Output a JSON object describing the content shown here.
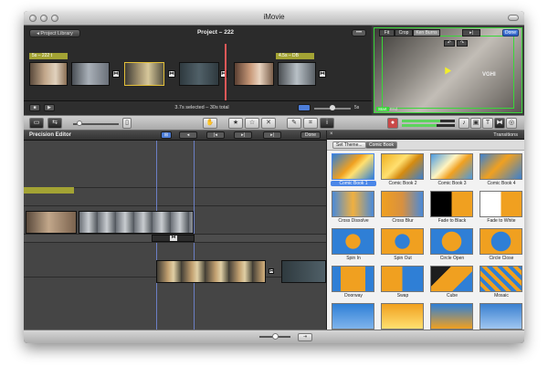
{
  "app": {
    "title": "iMovie"
  },
  "project": {
    "library_button": "◂ Project Library",
    "title": "Project – 222",
    "title_tags": [
      "5s – 222 t",
      "4.5s – DB"
    ],
    "status": "3.7s selected – 30s total",
    "zoom_label": "5s"
  },
  "viewer": {
    "buttons": [
      "Fit",
      "Crop",
      "Ken Burns"
    ],
    "active_button": "Ken Burns",
    "done": "Done",
    "start_label": "Start",
    "end_label": "End",
    "watermark": "VGHI"
  },
  "editor": {
    "title": "Precision Editor",
    "done": "Done"
  },
  "transitions": {
    "panel_title": "Transitions",
    "tabs": [
      "Set Theme...",
      "Comic Book"
    ],
    "active_tab": "Comic Book",
    "items": [
      {
        "label": "Comic Book 1",
        "selected": true
      },
      {
        "label": "Comic Book 2",
        "selected": false
      },
      {
        "label": "Comic Book 3",
        "selected": false
      },
      {
        "label": "Comic Book 4",
        "selected": false
      },
      {
        "label": "Cross Dissolve",
        "selected": false
      },
      {
        "label": "Cross Blur",
        "selected": false
      },
      {
        "label": "Fade to Black",
        "selected": false
      },
      {
        "label": "Fade to White",
        "selected": false
      },
      {
        "label": "Spin In",
        "selected": false
      },
      {
        "label": "Spin Out",
        "selected": false
      },
      {
        "label": "Circle Open",
        "selected": false
      },
      {
        "label": "Circle Close",
        "selected": false
      },
      {
        "label": "Doorway",
        "selected": false
      },
      {
        "label": "Swap",
        "selected": false
      },
      {
        "label": "Cube",
        "selected": false
      },
      {
        "label": "Mosaic",
        "selected": false
      },
      {
        "label": "",
        "selected": false
      },
      {
        "label": "",
        "selected": false
      },
      {
        "label": "",
        "selected": false
      },
      {
        "label": "",
        "selected": false
      }
    ]
  },
  "icons": {
    "close": "×",
    "play": "▶",
    "stop": "■",
    "rotate_left": "↶",
    "rotate_right": "↷",
    "next": "▸|",
    "hand": "✋",
    "star": "★",
    "star_empty": "☆",
    "reject": "✕",
    "wand": "✎",
    "crop": "⌗",
    "info": "i",
    "music": "♪",
    "camera": "▣",
    "text": "T",
    "globe": "◎",
    "transition": "⧓"
  },
  "colors": {
    "accent_green": "#39d739",
    "selection_yellow": "#e4c13a",
    "selection_blue": "#4a86e8",
    "playhead": "#e45858",
    "title_clip": "#a3a334"
  }
}
